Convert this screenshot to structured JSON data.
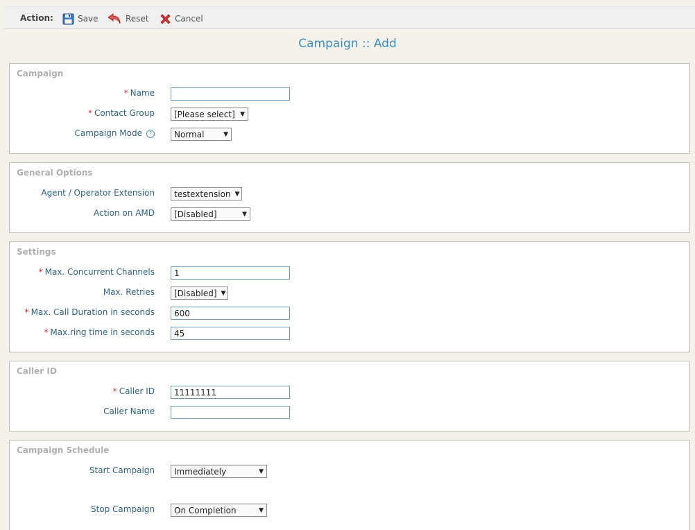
{
  "toolbar": {
    "action_label": "Action:",
    "save_label": "Save",
    "reset_label": "Reset",
    "cancel_label": "Cancel"
  },
  "page_title": "Campaign :: Add",
  "sections": {
    "campaign": {
      "title": "Campaign",
      "name_label": "Name",
      "name_value": "",
      "contact_group_label": "Contact Group",
      "contact_group_value": "[Please select]",
      "mode_label": "Campaign Mode",
      "mode_value": "Normal",
      "help_glyph": "?"
    },
    "general": {
      "title": "General Options",
      "extension_label": "Agent / Operator Extension",
      "extension_value": "testextension",
      "amd_label": "Action on AMD",
      "amd_value": "[Disabled]"
    },
    "settings": {
      "title": "Settings",
      "channels_label": "Max. Concurrent Channels",
      "channels_value": "1",
      "retries_label": "Max. Retries",
      "retries_value": "[Disabled]",
      "duration_label": "Max. Call Duration in seconds",
      "duration_value": "600",
      "ring_label": "Max.ring time in seconds",
      "ring_value": "45"
    },
    "callerid": {
      "title": "Caller ID",
      "id_label": "Caller ID",
      "id_value": "11111111",
      "name_label": "Caller Name",
      "name_value": ""
    },
    "schedule": {
      "title": "Campaign Schedule",
      "start_label": "Start Campaign",
      "start_value": "Immediately",
      "stop_label": "Stop Campaign",
      "stop_value": "On Completion"
    }
  },
  "required_mark": "*",
  "dropdown_arrow": "▼",
  "icons": {
    "save": "floppy-disk-icon",
    "reset": "undo-arrow-icon",
    "cancel": "red-x-icon",
    "help": "help-circle-icon"
  },
  "colors": {
    "accent": "#3b8fc0",
    "label": "#2f6485",
    "required": "#d03030",
    "section_title": "#b0b0b0"
  }
}
